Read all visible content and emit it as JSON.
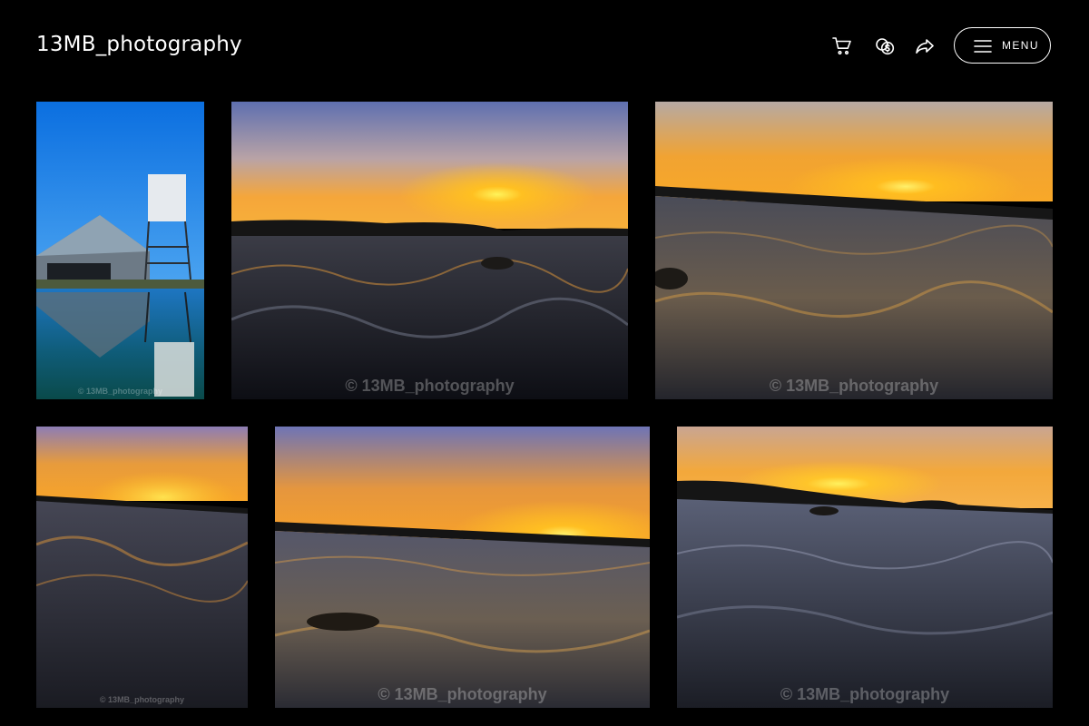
{
  "header": {
    "brand": "13MB_photography",
    "icons": [
      "cart-icon",
      "currency-icon",
      "share-icon",
      "menu-icon"
    ],
    "menu_label": "MENU"
  },
  "gallery": {
    "photos": [
      {
        "name": "photo-barn-water-tower",
        "watermark": "© 13MB_photography"
      },
      {
        "name": "photo-sunset-waves-1",
        "watermark": "© 13MB_photography"
      },
      {
        "name": "photo-sunset-sand-1",
        "watermark": "© 13MB_photography"
      },
      {
        "name": "photo-sunset-waves-2",
        "watermark": "© 13MB_photography"
      },
      {
        "name": "photo-sunset-sand-2",
        "watermark": "© 13MB_photography"
      },
      {
        "name": "photo-sunset-waves-3",
        "watermark": "© 13MB_photography"
      }
    ]
  },
  "colors": {
    "background": "#000000",
    "text": "#ffffff"
  }
}
